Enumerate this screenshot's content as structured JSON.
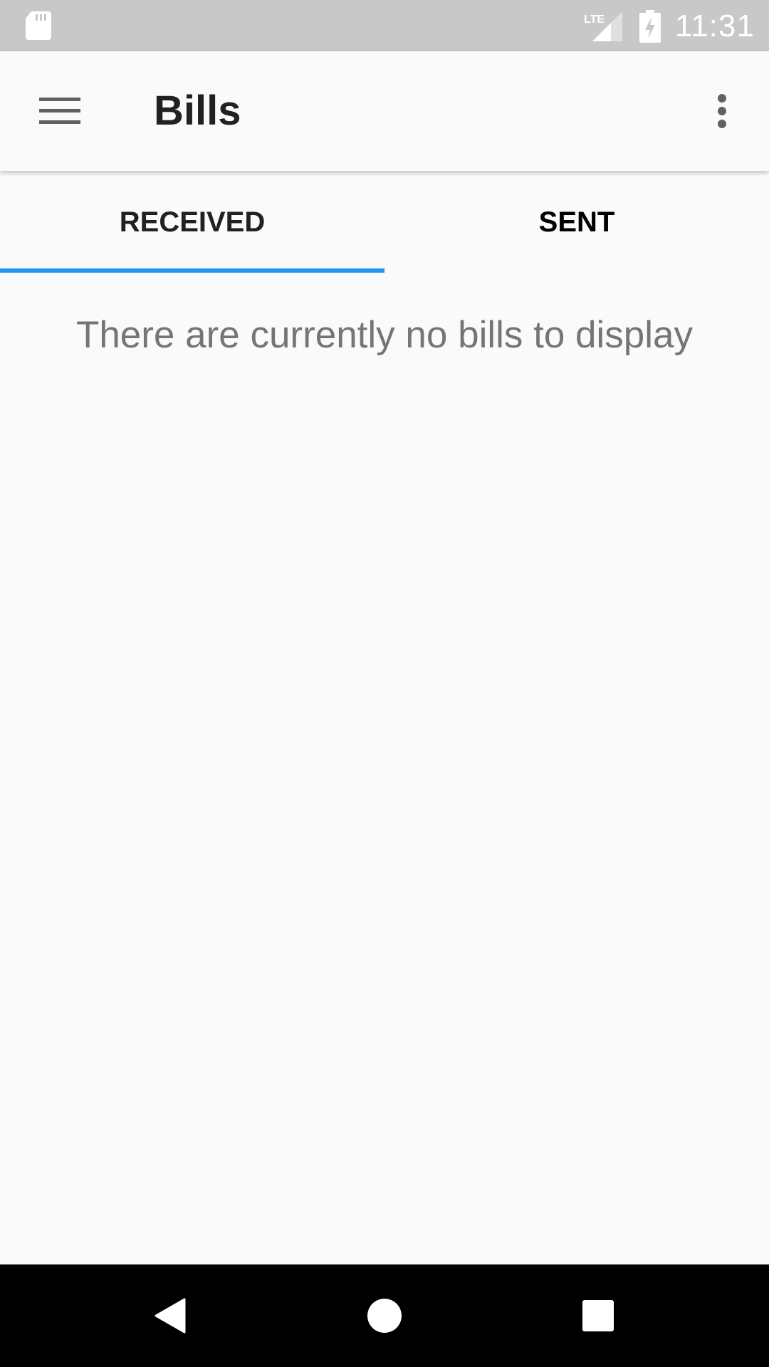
{
  "status_bar": {
    "time": "11:31",
    "network_label": "LTE",
    "icons": [
      "sd-card-icon",
      "lte-signal-icon",
      "battery-charging-icon"
    ]
  },
  "app_bar": {
    "title": "Bills",
    "left_icon": "menu-icon",
    "right_icon": "more-vert-icon"
  },
  "tabs": [
    {
      "label": "RECEIVED",
      "selected": true
    },
    {
      "label": "SENT",
      "selected": false
    }
  ],
  "empty_state": {
    "message": "There are currently no bills to display"
  },
  "nav_bar": {
    "icons": [
      "back-icon",
      "home-icon",
      "recents-icon"
    ]
  },
  "colors": {
    "status_bar": "#c8c8c8",
    "background": "#fafafa",
    "accent": "#2196f3",
    "title_text": "#212121",
    "secondary_text": "#757575",
    "nav_bar": "#000000"
  }
}
